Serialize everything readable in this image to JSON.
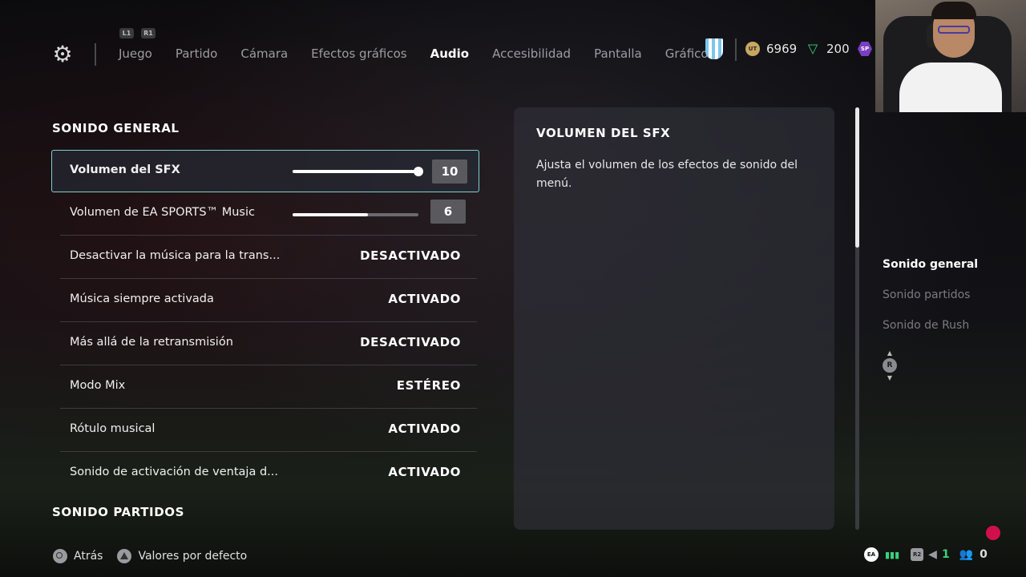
{
  "header": {
    "bumpers": [
      "L1",
      "R1"
    ],
    "tabs": [
      {
        "label": "Juego",
        "active": false
      },
      {
        "label": "Partido",
        "active": false
      },
      {
        "label": "Cámara",
        "active": false
      },
      {
        "label": "Efectos gráficos",
        "active": false
      },
      {
        "label": "Audio",
        "active": true
      },
      {
        "label": "Accesibilidad",
        "active": false
      },
      {
        "label": "Pantalla",
        "active": false
      },
      {
        "label": "Gráficos",
        "active": false
      }
    ],
    "coins": "6969",
    "points": "200",
    "coin_icon_text": "UT",
    "sp_icon_text": "SP"
  },
  "sections": {
    "general_title": "SONIDO GENERAL",
    "partidos_title": "SONIDO PARTIDOS"
  },
  "settings": [
    {
      "label": "Volumen del SFX",
      "type": "slider",
      "value": "10",
      "level": 1.0,
      "selected": true
    },
    {
      "label": "Volumen de EA SPORTS™ Music",
      "type": "slider",
      "value": "6",
      "level": 0.6,
      "selected": false
    },
    {
      "label": "Desactivar la música para la trans...",
      "type": "toggle",
      "value": "DESACTIVADO"
    },
    {
      "label": "Música siempre activada",
      "type": "toggle",
      "value": "ACTIVADO"
    },
    {
      "label": "Más allá de la retransmisión",
      "type": "toggle",
      "value": "DESACTIVADO"
    },
    {
      "label": "Modo Mix",
      "type": "toggle",
      "value": "ESTÉREO"
    },
    {
      "label": "Rótulo musical",
      "type": "toggle",
      "value": "ACTIVADO"
    },
    {
      "label": "Sonido de activación de ventaja d...",
      "type": "toggle",
      "value": "ACTIVADO"
    }
  ],
  "description": {
    "title": "VOLUMEN DEL SFX",
    "text": "Ajusta el volumen de los efectos de sonido del menú."
  },
  "jump_list": [
    {
      "label": "Sonido general",
      "active": true
    },
    {
      "label": "Sonido partidos",
      "active": false
    },
    {
      "label": "Sonido de Rush",
      "active": false
    }
  ],
  "rstick_label": "R",
  "footer": {
    "back_label": "Atrás",
    "defaults_label": "Valores por defecto"
  },
  "status": {
    "ea_text": "EA",
    "r2_text": "R2",
    "count_green": "1",
    "friends_count": "0"
  },
  "colors": {
    "accent_outline": "#7ecfd0",
    "points_green": "#38d27a",
    "record_red": "#d0104a",
    "sp_purple": "#7a3fc0"
  }
}
